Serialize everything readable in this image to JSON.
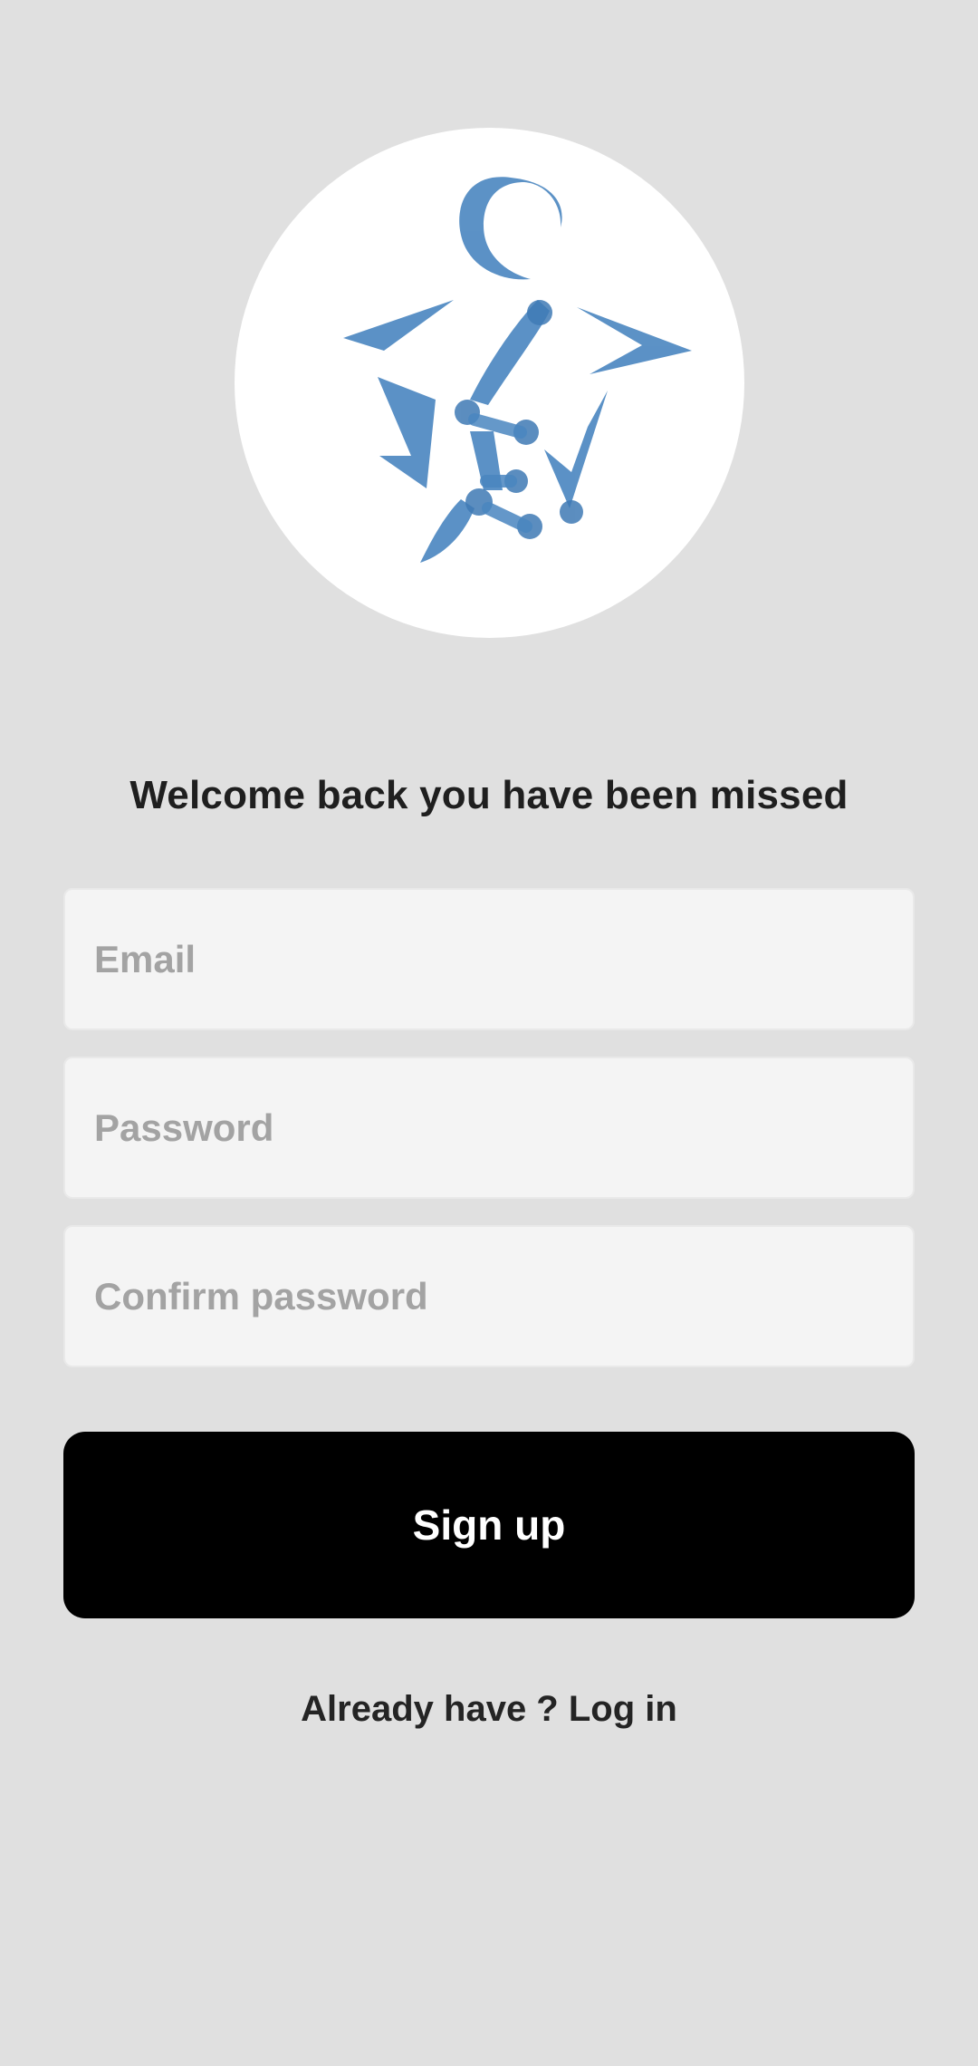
{
  "logo": {
    "icon": "jev-robot-logo-icon",
    "color": "#4a86c0"
  },
  "welcome_text": "Welcome back you have been missed",
  "form": {
    "email_placeholder": "Email",
    "password_placeholder": "Password",
    "confirm_password_placeholder": "Confirm password",
    "submit_label": "Sign up"
  },
  "footer": {
    "login_prompt": "Already have ? Log in"
  }
}
